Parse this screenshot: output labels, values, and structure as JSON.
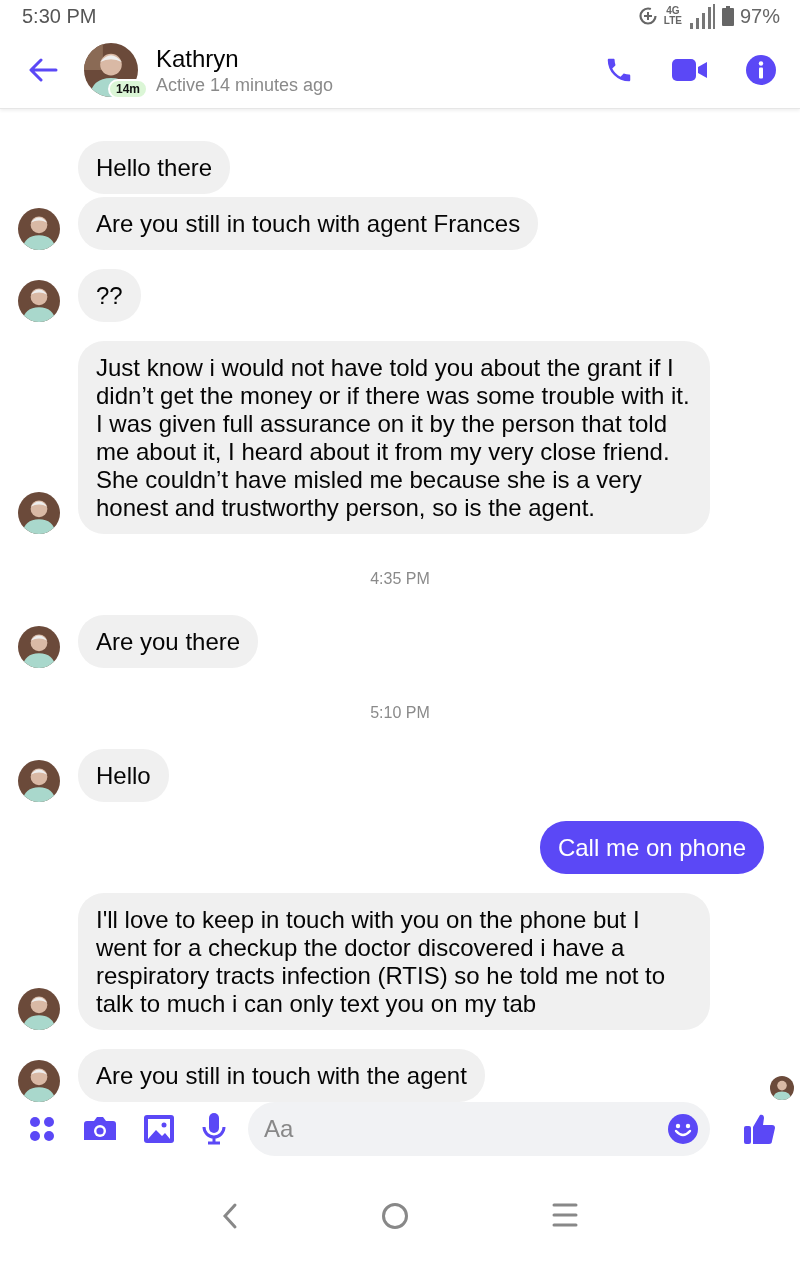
{
  "status_bar": {
    "time": "5:30 PM",
    "network": "4G",
    "network_sub": "LTE",
    "battery": "97%"
  },
  "header": {
    "name": "Kathryn",
    "status": "Active 14 minutes ago",
    "active_badge": "14m"
  },
  "messages": [
    {
      "kind": "incoming",
      "text": "Hello there",
      "avatar": false,
      "seen": false
    },
    {
      "kind": "incoming",
      "text": "Are you still in touch with agent Frances",
      "avatar": true,
      "seen": false
    },
    {
      "kind": "incoming",
      "text": "??",
      "avatar": true,
      "seen": false
    },
    {
      "kind": "incoming",
      "text": "Just know i would not have told you about the grant if I didn’t get the money or if there was some trouble with it. I was given full assurance on it by the person that told me about it, I heard about it from my very close friend. She couldn’t have misled me because she is a very honest and trustworthy person, so is the agent.",
      "avatar": true,
      "seen": false
    },
    {
      "kind": "time",
      "text": "4:35 PM"
    },
    {
      "kind": "incoming",
      "text": "Are you there",
      "avatar": true,
      "seen": false
    },
    {
      "kind": "time",
      "text": "5:10 PM"
    },
    {
      "kind": "incoming",
      "text": "Hello",
      "avatar": true,
      "seen": false
    },
    {
      "kind": "outgoing",
      "text": "Call me on phone"
    },
    {
      "kind": "incoming",
      "text": "I'll love to keep in touch with you on the phone but I went for a checkup the doctor discovered i have a respiratory tracts infection (RTIS) so he told me not to talk to much i can only text you on my tab",
      "avatar": true,
      "seen": false
    },
    {
      "kind": "incoming",
      "text": "Are you still in touch with the agent",
      "avatar": true,
      "seen": true
    }
  ],
  "composer": {
    "placeholder": "Aa"
  }
}
